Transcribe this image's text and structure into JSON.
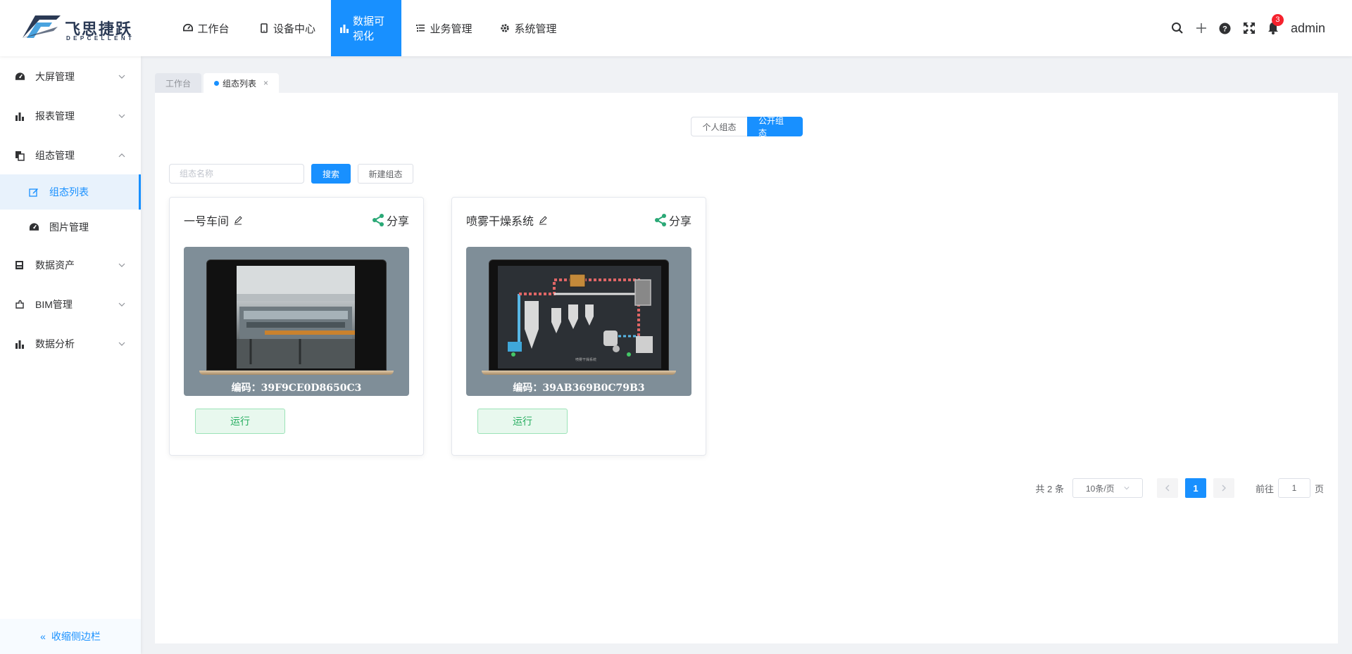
{
  "header": {
    "logo_text": "飞思捷跃",
    "logo_sub": "DEPCELLENT",
    "nav": [
      {
        "label": "工作台",
        "icon": "dashboard-icon"
      },
      {
        "label": "设备中心",
        "icon": "mobile-icon"
      },
      {
        "label": "数据可视化",
        "icon": "bar-chart-icon",
        "active": true
      },
      {
        "label": "业务管理",
        "icon": "list-icon"
      },
      {
        "label": "系统管理",
        "icon": "gear-icon"
      }
    ],
    "notification_count": "3",
    "username": "admin"
  },
  "sidebar": {
    "items": [
      {
        "label": "大屏管理",
        "icon": "dashboard-icon"
      },
      {
        "label": "报表管理",
        "icon": "bar-chart-icon"
      },
      {
        "label": "组态管理",
        "icon": "copy-icon",
        "expanded": true
      },
      {
        "label": "数据资产",
        "icon": "database-icon"
      },
      {
        "label": "BIM管理",
        "icon": "puzzle-icon"
      },
      {
        "label": "数据分析",
        "icon": "bar-chart-icon"
      }
    ],
    "sub_items": [
      {
        "label": "组态列表",
        "icon": "edit-icon",
        "active": true
      },
      {
        "label": "图片管理",
        "icon": "dashboard-icon"
      }
    ],
    "collapse_label": "收缩侧边栏"
  },
  "tabs": [
    {
      "label": "工作台"
    },
    {
      "label": "组态列表",
      "active": true
    }
  ],
  "toggle": {
    "personal": "个人组态",
    "public": "公开组态"
  },
  "search": {
    "placeholder": "组态名称",
    "search_label": "搜索",
    "new_label": "新建组态"
  },
  "cards": [
    {
      "title": "一号车间",
      "share_label": "分享",
      "code": "编码：39F9CE0D8650C3",
      "run_label": "运行"
    },
    {
      "title": "喷雾干燥系统",
      "share_label": "分享",
      "code": "编码：39AB369B0C79B3",
      "run_label": "运行"
    }
  ],
  "pagination": {
    "total": "共 2 条",
    "page_size": "10条/页",
    "current_page": "1",
    "goto_prefix": "前往",
    "goto_value": "1",
    "goto_suffix": "页"
  },
  "colors": {
    "primary": "#1890ff",
    "run_green": "#27ae60",
    "share_green": "#2aa876"
  }
}
